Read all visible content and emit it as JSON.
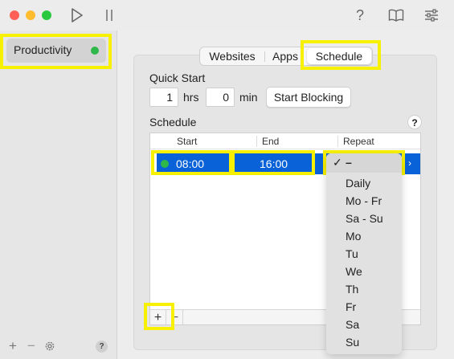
{
  "toolbar": {
    "help_label": "?"
  },
  "sidebar": {
    "items": [
      {
        "label": "Productivity",
        "status_color": "#2eb84a"
      }
    ],
    "add_label": "+",
    "remove_label": "−",
    "help_label": "?"
  },
  "tabs": [
    {
      "label": "Websites"
    },
    {
      "label": "Apps"
    },
    {
      "label": "Schedule"
    }
  ],
  "quick_start": {
    "title": "Quick Start",
    "hours_value": "1",
    "hours_unit": "hrs",
    "minutes_value": "0",
    "minutes_unit": "min",
    "start_button": "Start Blocking"
  },
  "schedule": {
    "title": "Schedule",
    "help_label": "?",
    "columns": {
      "start": "Start",
      "end": "End",
      "repeat": "Repeat"
    },
    "rows": [
      {
        "start": "08:00",
        "end": "16:00",
        "status_color": "#2eb84a"
      }
    ],
    "add_label": "+",
    "remove_label": "−",
    "repeat_menu": {
      "selected": "–",
      "checkmark": "✓",
      "options": [
        "Daily",
        "Mo - Fr",
        "Sa - Su",
        "Mo",
        "Tu",
        "We",
        "Th",
        "Fr",
        "Sa",
        "Su"
      ]
    }
  }
}
